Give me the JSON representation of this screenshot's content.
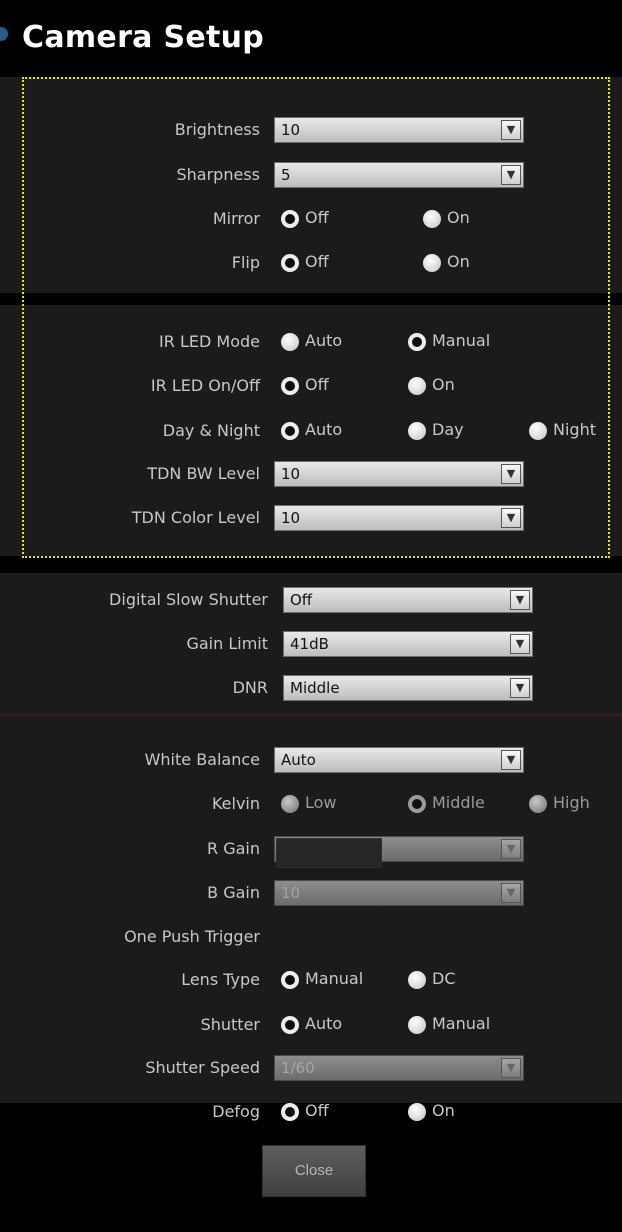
{
  "title": "Camera Setup",
  "colors": {
    "highlight": "#e6e600",
    "panel": "#1b1b1b",
    "divider_purple": "#2a1a2a"
  },
  "image_settings": {
    "brightness": {
      "label": "Brightness",
      "value": "10"
    },
    "sharpness": {
      "label": "Sharpness",
      "value": "5"
    },
    "mirror": {
      "label": "Mirror",
      "options": [
        "Off",
        "On"
      ],
      "selected": "Off"
    },
    "flip": {
      "label": "Flip",
      "options": [
        "Off",
        "On"
      ],
      "selected": "Off"
    }
  },
  "ir_settings": {
    "ir_led_mode": {
      "label": "IR LED Mode",
      "options": [
        "Auto",
        "Manual"
      ],
      "selected": "Manual"
    },
    "ir_led_onoff": {
      "label": "IR LED On/Off",
      "options": [
        "Off",
        "On"
      ],
      "selected": "Off"
    },
    "day_night": {
      "label": "Day & Night",
      "options": [
        "Auto",
        "Day",
        "Night"
      ],
      "selected": "Auto"
    },
    "tdn_bw_level": {
      "label": "TDN BW Level",
      "value": "10"
    },
    "tdn_color_level": {
      "label": "TDN Color Level",
      "value": "10"
    }
  },
  "exposure_settings": {
    "digital_slow_shutter": {
      "label": "Digital Slow Shutter",
      "value": "Off"
    },
    "gain_limit": {
      "label": "Gain Limit",
      "value": "41dB"
    },
    "dnr": {
      "label": "DNR",
      "value": "Middle"
    }
  },
  "wb_settings": {
    "white_balance": {
      "label": "White Balance",
      "value": "Auto"
    },
    "kelvin": {
      "label": "Kelvin",
      "options": [
        "Low",
        "Middle",
        "High"
      ],
      "selected": "Middle",
      "disabled": true
    },
    "r_gain": {
      "label": "R Gain",
      "value": "10",
      "disabled": true
    },
    "b_gain": {
      "label": "B Gain",
      "value": "10",
      "disabled": true
    },
    "one_push_trigger": {
      "label": "One Push Trigger"
    },
    "lens_type": {
      "label": "Lens Type",
      "options": [
        "Manual",
        "DC"
      ],
      "selected": "Manual"
    },
    "shutter": {
      "label": "Shutter",
      "options": [
        "Auto",
        "Manual"
      ],
      "selected": "Auto"
    },
    "shutter_speed": {
      "label": "Shutter Speed",
      "value": "1/60",
      "disabled": true
    },
    "defog": {
      "label": "Defog",
      "options": [
        "Off",
        "On"
      ],
      "selected": "Off"
    }
  },
  "close_label": "Close"
}
